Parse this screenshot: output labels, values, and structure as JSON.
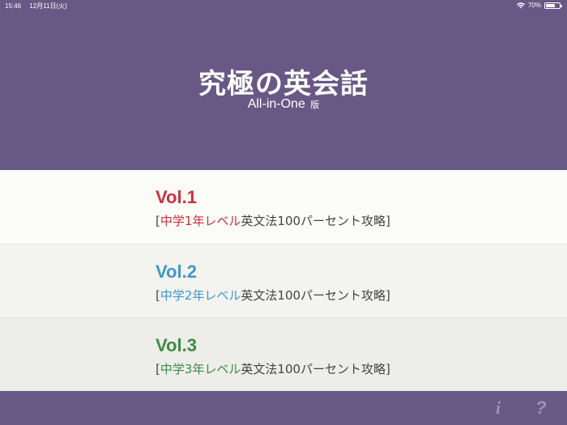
{
  "status_bar": {
    "time": "15:46",
    "date": "12月11日(火)",
    "battery": "70%",
    "battery_level": 0.7
  },
  "header": {
    "title": "究極の英会話",
    "subtitle_en": "All-in-One",
    "subtitle_ja": "版"
  },
  "volumes": [
    {
      "title": "Vol.1",
      "bracket_open": "[",
      "level": "中学1年レベル",
      "rest": "英文法100パーセント攻略",
      "bracket_close": "]",
      "color": "#c8323f"
    },
    {
      "title": "Vol.2",
      "bracket_open": "[",
      "level": "中学2年レベル",
      "rest": "英文法100パーセント攻略",
      "bracket_close": "]",
      "color": "#3f98c9"
    },
    {
      "title": "Vol.3",
      "bracket_open": "[",
      "level": "中学3年レベル",
      "rest": "英文法100パーセント攻略",
      "bracket_close": "]",
      "color": "#3e8a45"
    }
  ],
  "footer": {
    "info_icon": "info-icon",
    "help_icon": "help-icon",
    "info_label": "i",
    "help_label": "?"
  },
  "colors": {
    "background": "#675885",
    "footer_icon": "#9d92b8"
  }
}
